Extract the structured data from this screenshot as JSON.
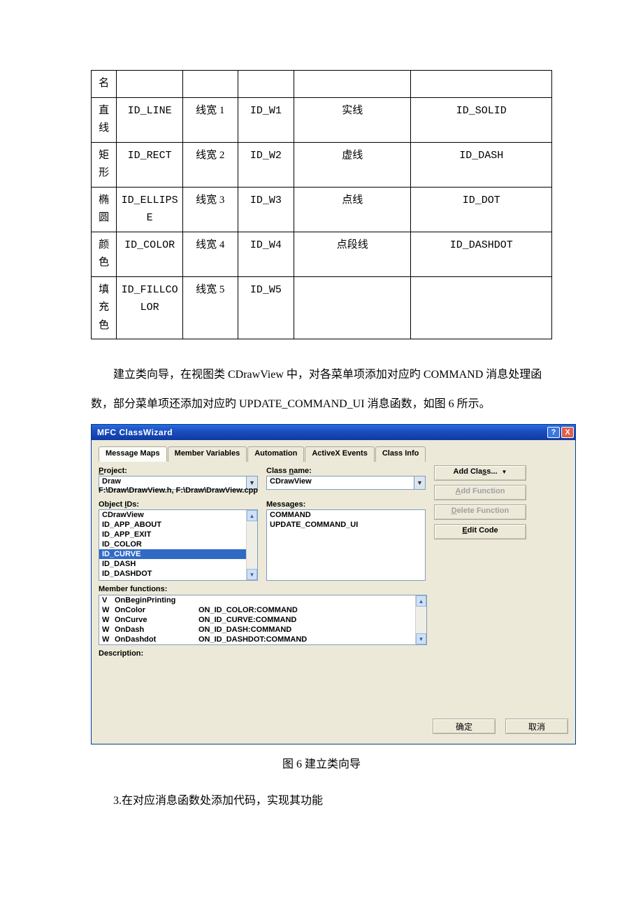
{
  "table": {
    "rows": [
      {
        "c0": "名",
        "c1": "",
        "c2": "",
        "c3": "",
        "c4": "",
        "c5": ""
      },
      {
        "c0": "直线",
        "c1": "ID_LINE",
        "c2": "线宽 1",
        "c3": "ID_W1",
        "c4": "实线",
        "c5": "ID_SOLID"
      },
      {
        "c0": "矩形",
        "c1": "ID_RECT",
        "c2": "线宽 2",
        "c3": "ID_W2",
        "c4": "虚线",
        "c5": "ID_DASH"
      },
      {
        "c0": "椭圆",
        "c1": "ID_ELLIPSE",
        "c2": "线宽 3",
        "c3": "ID_W3",
        "c4": "点线",
        "c5": "ID_DOT"
      },
      {
        "c0": "颜色",
        "c1": "ID_COLOR",
        "c2": "线宽 4",
        "c3": "ID_W4",
        "c4": "点段线",
        "c5": "ID_DASHDOT"
      },
      {
        "c0": "填充色",
        "c1": "ID_FILLCOLOR",
        "c2": "线宽 5",
        "c3": "ID_W5",
        "c4": "",
        "c5": ""
      }
    ]
  },
  "body_text": {
    "p1": "建立类向导，在视图类 CDrawView 中，对各菜单项添加对应旳 COMMAND 消息处理函数，部分菜单项还添加对应旳 UPDATE_COMMAND_UI 消息函数，如图 6 所示。",
    "caption": "图 6    建立类向导",
    "p2": "3.在对应消息函数处添加代码，实现其功能"
  },
  "dialog": {
    "title": "MFC ClassWizard",
    "help": "?",
    "close": "X",
    "tabs": [
      "Message Maps",
      "Member Variables",
      "Automation",
      "ActiveX Events",
      "Class Info"
    ],
    "active_tab": 0,
    "project_label": "Project:",
    "project_value": "Draw",
    "classname_label": "Class name:",
    "classname_value": "CDrawView",
    "path": "F:\\Draw\\DrawView.h, F:\\Draw\\DrawView.cpp",
    "objectids_label": "Object IDs:",
    "object_ids": [
      "CDrawView",
      "ID_APP_ABOUT",
      "ID_APP_EXIT",
      "ID_COLOR",
      "ID_CURVE",
      "ID_DASH",
      "ID_DASHDOT"
    ],
    "object_ids_selected": 4,
    "messages_label": "Messages:",
    "messages": [
      "COMMAND",
      "UPDATE_COMMAND_UI"
    ],
    "buttons": {
      "add_class": "Add Class...",
      "add_function": "Add Function",
      "delete_function": "Delete Function",
      "edit_code": "Edit Code"
    },
    "memberfuncs_label": "Member functions:",
    "member_functions": [
      {
        "t": "V",
        "name": "OnBeginPrinting",
        "map": ""
      },
      {
        "t": "W",
        "name": "OnColor",
        "map": "ON_ID_COLOR:COMMAND"
      },
      {
        "t": "W",
        "name": "OnCurve",
        "map": "ON_ID_CURVE:COMMAND"
      },
      {
        "t": "W",
        "name": "OnDash",
        "map": "ON_ID_DASH:COMMAND"
      },
      {
        "t": "W",
        "name": "OnDashdot",
        "map": "ON_ID_DASHDOT:COMMAND"
      }
    ],
    "description_label": "Description:",
    "ok": "确定",
    "cancel": "取消"
  }
}
